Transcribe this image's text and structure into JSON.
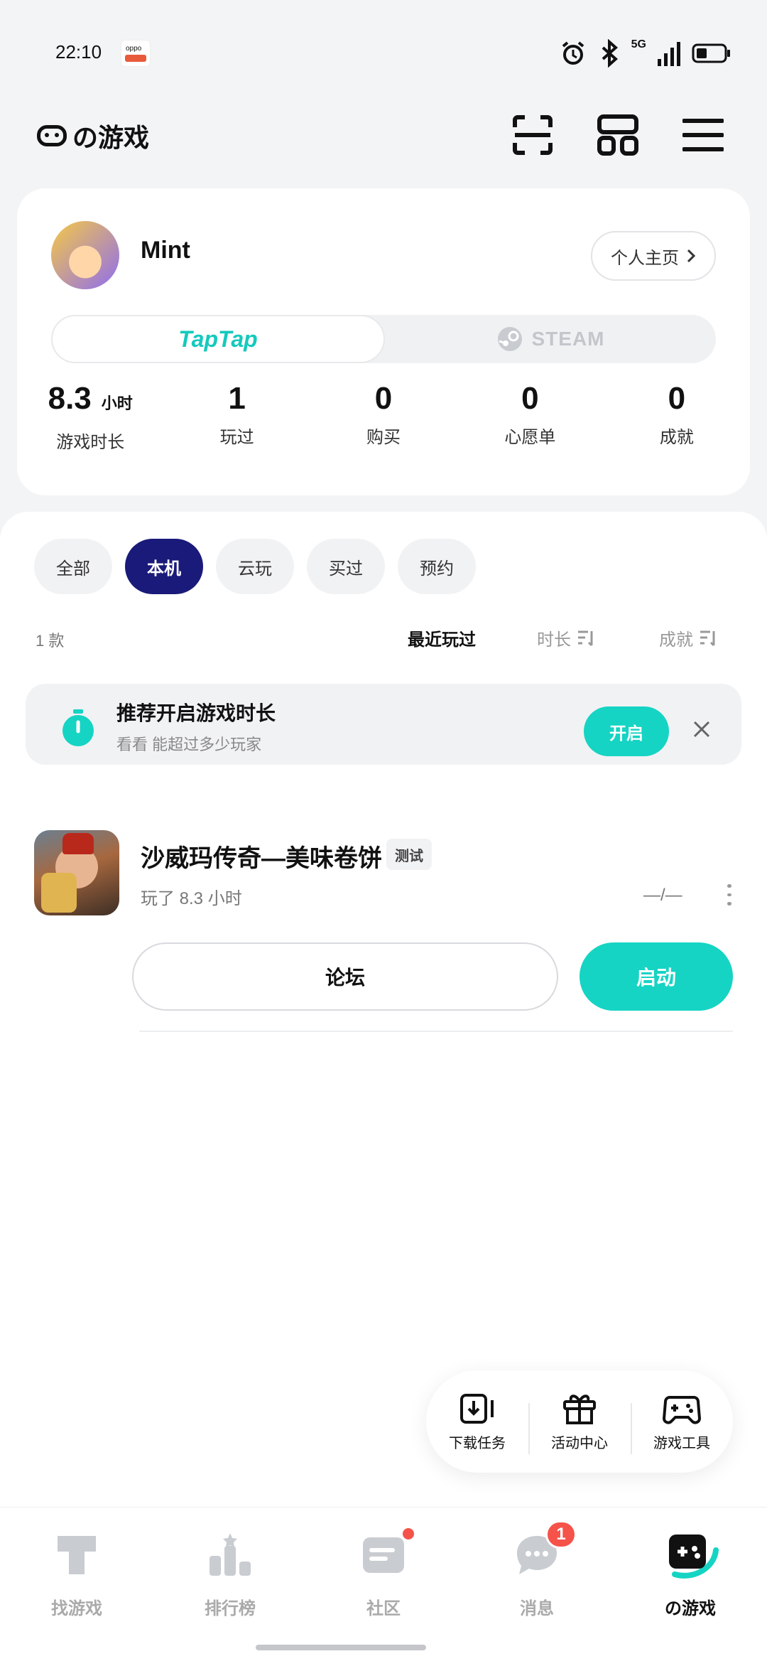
{
  "status_bar": {
    "time": "22:10",
    "app_badge_text": "oppo",
    "network": "5G"
  },
  "header": {
    "brand": "の游戏"
  },
  "profile": {
    "username": "Mint",
    "profile_link": "个人主页",
    "platform_tabs": [
      "TapTap",
      "STEAM"
    ],
    "stats": [
      {
        "value": "8.3",
        "unit": "小时",
        "label": "游戏时长"
      },
      {
        "value": "1",
        "unit": "",
        "label": "玩过"
      },
      {
        "value": "0",
        "unit": "",
        "label": "购买"
      },
      {
        "value": "0",
        "unit": "",
        "label": "心愿单"
      },
      {
        "value": "0",
        "unit": "",
        "label": "成就"
      }
    ]
  },
  "filters": [
    "全部",
    "本机",
    "云玩",
    "买过",
    "预约"
  ],
  "list": {
    "count": "1 款",
    "sort_recent": "最近玩过",
    "sort_duration": "时长",
    "sort_achievement": "成就"
  },
  "promo": {
    "title": "推荐开启游戏时长",
    "subtitle": "看看 能超过多少玩家",
    "action": "开启"
  },
  "game": {
    "title": "沙威玛传奇—美味卷饼",
    "badge": "测试",
    "meta": "玩了 8.3 小时",
    "achievement": "—/—",
    "forum_label": "论坛",
    "launch_label": "启动"
  },
  "floating_toolbar": [
    "下载任务",
    "活动中心",
    "游戏工具"
  ],
  "bottom_nav": {
    "items": [
      "找游戏",
      "排行榜",
      "社区",
      "消息",
      "の游戏"
    ],
    "message_badge": "1"
  },
  "colors": {
    "accent": "#15d4c3",
    "chip_active": "#1a1a7a",
    "badge": "#f5534a"
  }
}
